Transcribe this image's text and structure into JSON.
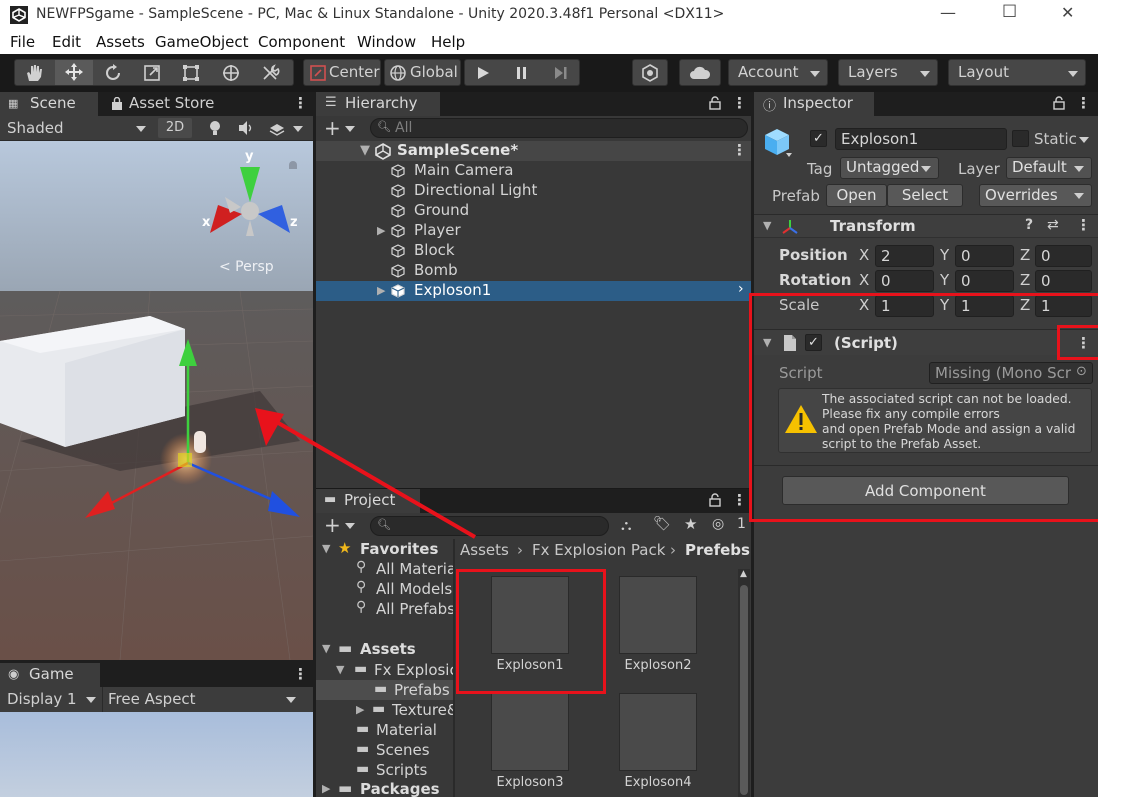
{
  "window": {
    "title": "NEWFPSgame - SampleScene - PC, Mac & Linux Standalone - Unity 2020.3.48f1 Personal <DX11>",
    "controls": [
      "—",
      "☐",
      "✕"
    ]
  },
  "menu": [
    "File",
    "Edit",
    "Assets",
    "GameObject",
    "Component",
    "Window",
    "Help"
  ],
  "toolbar": {
    "pivot_label": "Center",
    "space_label": "Global",
    "account_label": "Account",
    "layers_label": "Layers",
    "layout_label": "Layout"
  },
  "scene": {
    "tab_scene": "Scene",
    "tab_asset_store": "Asset Store",
    "shading_mode": "Shaded",
    "mode_2d": "2D",
    "gizmo_y": "y",
    "gizmo_x": "x",
    "gizmo_z": "z",
    "persp_label": "< Persp"
  },
  "game": {
    "tab": "Game",
    "display": "Display 1",
    "aspect": "Free Aspect"
  },
  "hierarchy": {
    "tab": "Hierarchy",
    "search_placeholder": "All",
    "scene_name": "SampleScene*",
    "items": [
      {
        "label": "Main Camera",
        "expandable": false,
        "selected": false
      },
      {
        "label": "Directional Light",
        "expandable": false,
        "selected": false
      },
      {
        "label": "Ground",
        "expandable": false,
        "selected": false
      },
      {
        "label": "Player",
        "expandable": true,
        "selected": false
      },
      {
        "label": "Block",
        "expandable": false,
        "selected": false
      },
      {
        "label": "Bomb",
        "expandable": false,
        "selected": false
      },
      {
        "label": "Exploson1",
        "expandable": true,
        "selected": true
      }
    ]
  },
  "project": {
    "tab": "Project",
    "hidden_count": "1",
    "favorites_label": "Favorites",
    "favorites": [
      "All Materia",
      "All Models",
      "All Prefabs"
    ],
    "assets_label": "Assets",
    "tree": [
      {
        "label": "Fx Explosic",
        "depth": 1,
        "selected": false
      },
      {
        "label": "Prefabs",
        "depth": 2,
        "selected": true
      },
      {
        "label": "Texture&",
        "depth": 2,
        "selected": false
      },
      {
        "label": "Material",
        "depth": 1,
        "selected": false
      },
      {
        "label": "Scenes",
        "depth": 1,
        "selected": false
      },
      {
        "label": "Scripts",
        "depth": 1,
        "selected": false
      }
    ],
    "packages_label": "Packages",
    "breadcrumb": [
      "Assets",
      "Fx Explosion Pack",
      "Prefebs"
    ],
    "assets": [
      "Exploson1",
      "Exploson2",
      "Exploson3",
      "Exploson4"
    ]
  },
  "inspector": {
    "tab": "Inspector",
    "object_name": "Exploson1",
    "static_label": "Static",
    "tag_label": "Tag",
    "tag_value": "Untagged",
    "layer_label": "Layer",
    "layer_value": "Default",
    "prefab_label": "Prefab",
    "open_label": "Open",
    "select_label": "Select",
    "overrides_label": "Overrides",
    "transform": {
      "title": "Transform",
      "position_label": "Position",
      "rotation_label": "Rotation",
      "scale_label": "Scale",
      "position": {
        "x": "2",
        "y": "0",
        "z": "0"
      },
      "rotation": {
        "x": "0",
        "y": "0",
        "z": "0"
      },
      "scale": {
        "x": "1",
        "y": "1",
        "z": "1"
      },
      "axis_x": "X",
      "axis_y": "Y",
      "axis_z": "Z"
    },
    "script_component": {
      "title": "(Script)",
      "script_label": "Script",
      "script_value": "Missing (Mono Scr",
      "warning_lines": [
        "The associated script can not be loaded.",
        "Please fix any compile errors",
        "and open Prefab Mode and assign a valid",
        "script to the Prefab Asset."
      ]
    },
    "add_component_label": "Add Component"
  },
  "colors": {
    "annotation_red": "#e8121b",
    "selection_blue": "#2c5d87",
    "panel_bg": "#383838"
  }
}
